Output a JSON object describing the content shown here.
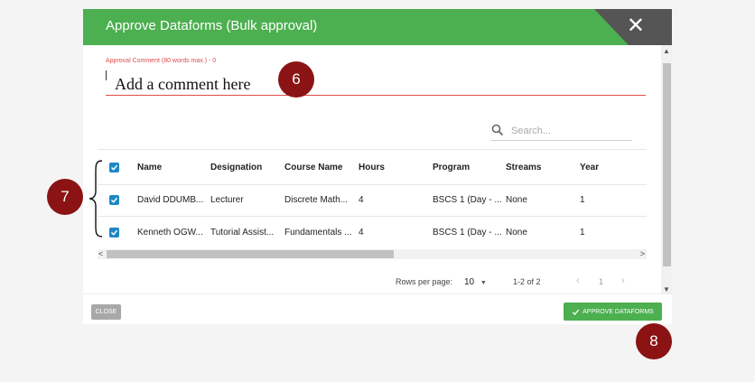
{
  "dialog": {
    "title": "Approve Dataforms (Bulk approval)",
    "close_icon": "close-icon"
  },
  "comment": {
    "label": "Approval Comment (80 words max.) - 0",
    "placeholder": "Add a comment here"
  },
  "search": {
    "placeholder": "Search..."
  },
  "table": {
    "headers": [
      "Name",
      "Designation",
      "Course Name",
      "Hours",
      "Program",
      "Streams",
      "Year"
    ],
    "rows": [
      [
        "David DDUMB...",
        "Lecturer",
        "Discrete Math...",
        "4",
        "BSCS 1 (Day - ...",
        "None",
        "1"
      ],
      [
        "Kenneth OGW...",
        "Tutorial Assist...",
        "Fundamentals ...",
        "4",
        "BSCS 1 (Day - ...",
        "None",
        "1"
      ]
    ]
  },
  "pagination": {
    "rows_per_page_label": "Rows per page:",
    "rows_per_page_value": "10",
    "range": "1-2 of 2",
    "current_page": "1"
  },
  "footer": {
    "close_label": "CLOSE",
    "approve_label": "APPROVE DATAFORMS"
  },
  "annotations": {
    "badge_6": "6",
    "badge_7": "7",
    "badge_8": "8"
  },
  "colors": {
    "header_green": "#4caf50",
    "close_corner": "#555555",
    "checkbox_blue": "#1e88c5",
    "badge_red": "#8b1313",
    "error_red": "#e04c4c"
  }
}
